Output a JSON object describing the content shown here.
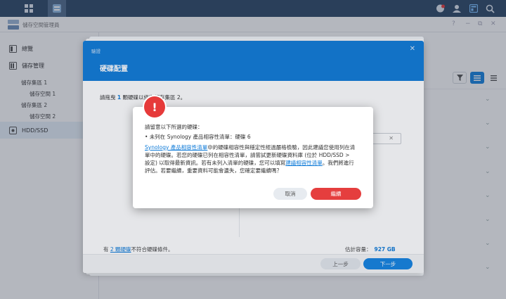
{
  "app": {
    "title": "儲存空間管理員"
  },
  "window_controls": {
    "help": "?",
    "minimize": "−",
    "restore": "⧉",
    "close": "✕"
  },
  "sidebar": {
    "overview": "總覽",
    "storage": "儲存管理",
    "sub": [
      {
        "label": "儲存集區 1"
      },
      {
        "label": "儲存空間 1"
      },
      {
        "label": "儲存集區 2"
      },
      {
        "label": "儲存空間 2"
      }
    ],
    "hdd": "HDD/SSD"
  },
  "wizard": {
    "label": "驗證",
    "close": "✕",
    "title": "硬碟配置",
    "instruction_prefix": "請拖曳",
    "instruction_num": "1",
    "instruction_suffix": "顆硬碟以修復儲存集區 2。",
    "filter_clear": "✕",
    "footer_left_prefix": "有",
    "footer_left_link": "2 顆硬碟",
    "footer_left_suffix": "不符合硬碟條件。",
    "capacity_label": "估計容量：",
    "capacity_value": "927 GB",
    "prev": "上一步",
    "next": "下一步"
  },
  "alert": {
    "badge": "!",
    "line1": "請留意以下所選的硬碟：",
    "line2": "• 未列在 Synology 產品相容性清單：硬碟 6",
    "line3_link": "Synology 產品相容性清單",
    "line3_rest": "中的硬碟相容性與穩定性經過嚴格檢驗，因此建議您使用列在清",
    "line4": "單中的硬碟。若您的硬碟已列在相容性清單，請嘗試更新硬碟資料庫 (位於 HDD/SSD >",
    "line5_a": "設定) 以取得最新資訊。若有未列入清單的硬碟，您可以填寫",
    "line5_link": "建議相容性清單",
    "line5_b": "。我們將進行",
    "line6": "評估。若要繼續，重要資料可能會遺失，您確定要繼續嗎？",
    "cancel": "取消",
    "continue": "繼續"
  },
  "icons": [
    "grid-icon",
    "storage-manager-icon",
    "chat-icon",
    "user-icon",
    "widget-icon",
    "search-icon",
    "filter-icon",
    "list-view-icon",
    "menu-icon",
    "chevron-down-icon"
  ],
  "colors": {
    "accent": "#0f7bd8",
    "danger": "#e53e3e",
    "taskbar": "#2c4766"
  }
}
